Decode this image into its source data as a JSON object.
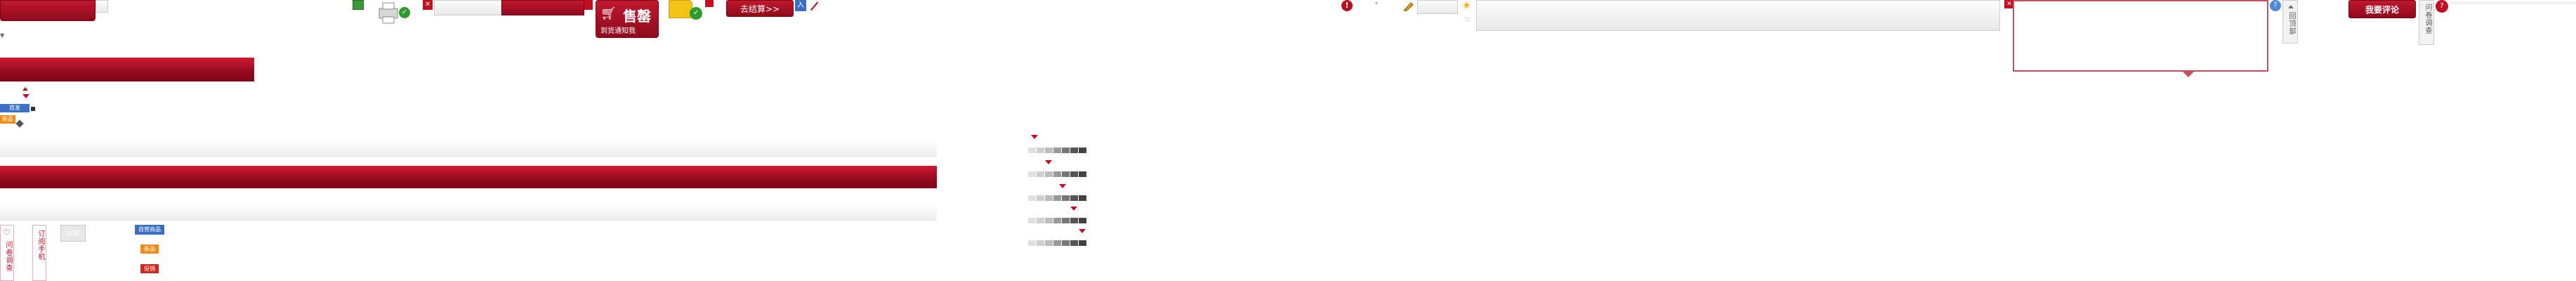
{
  "cart_tag": {
    "title": "售罄",
    "subtitle": "到货通知我"
  },
  "checkout_button": {
    "label": "去结算>>"
  },
  "review_button": {
    "label": "我要评论"
  },
  "back_to_top": {
    "label": "回顶部"
  },
  "survey_right": {
    "label": "问卷调查"
  },
  "survey_left": {
    "label": "问卷调查"
  },
  "feedback_left": {
    "label": "订阅手机"
  },
  "join_label": {
    "label": "入"
  },
  "badges": {
    "blue_small": "首发",
    "blue_wide": "自营商品",
    "orange": "新品",
    "red": "促销"
  },
  "grey_button": {
    "label": "比较"
  },
  "colors": {
    "brand_red": "#b0102a",
    "accent_red": "#c40c22",
    "check_green": "#2e9b2e",
    "folder_yellow": "#f2c318",
    "info_blue": "#3a6fc4"
  },
  "icons": [
    "warning-circle-icon",
    "pencil-icon",
    "star-icon",
    "close-icon",
    "checkmark-icon",
    "folder-icon",
    "cart-icon",
    "printer-icon",
    "chevron-down-icon",
    "heart-icon",
    "question-icon",
    "speech-bubble-icon"
  ]
}
